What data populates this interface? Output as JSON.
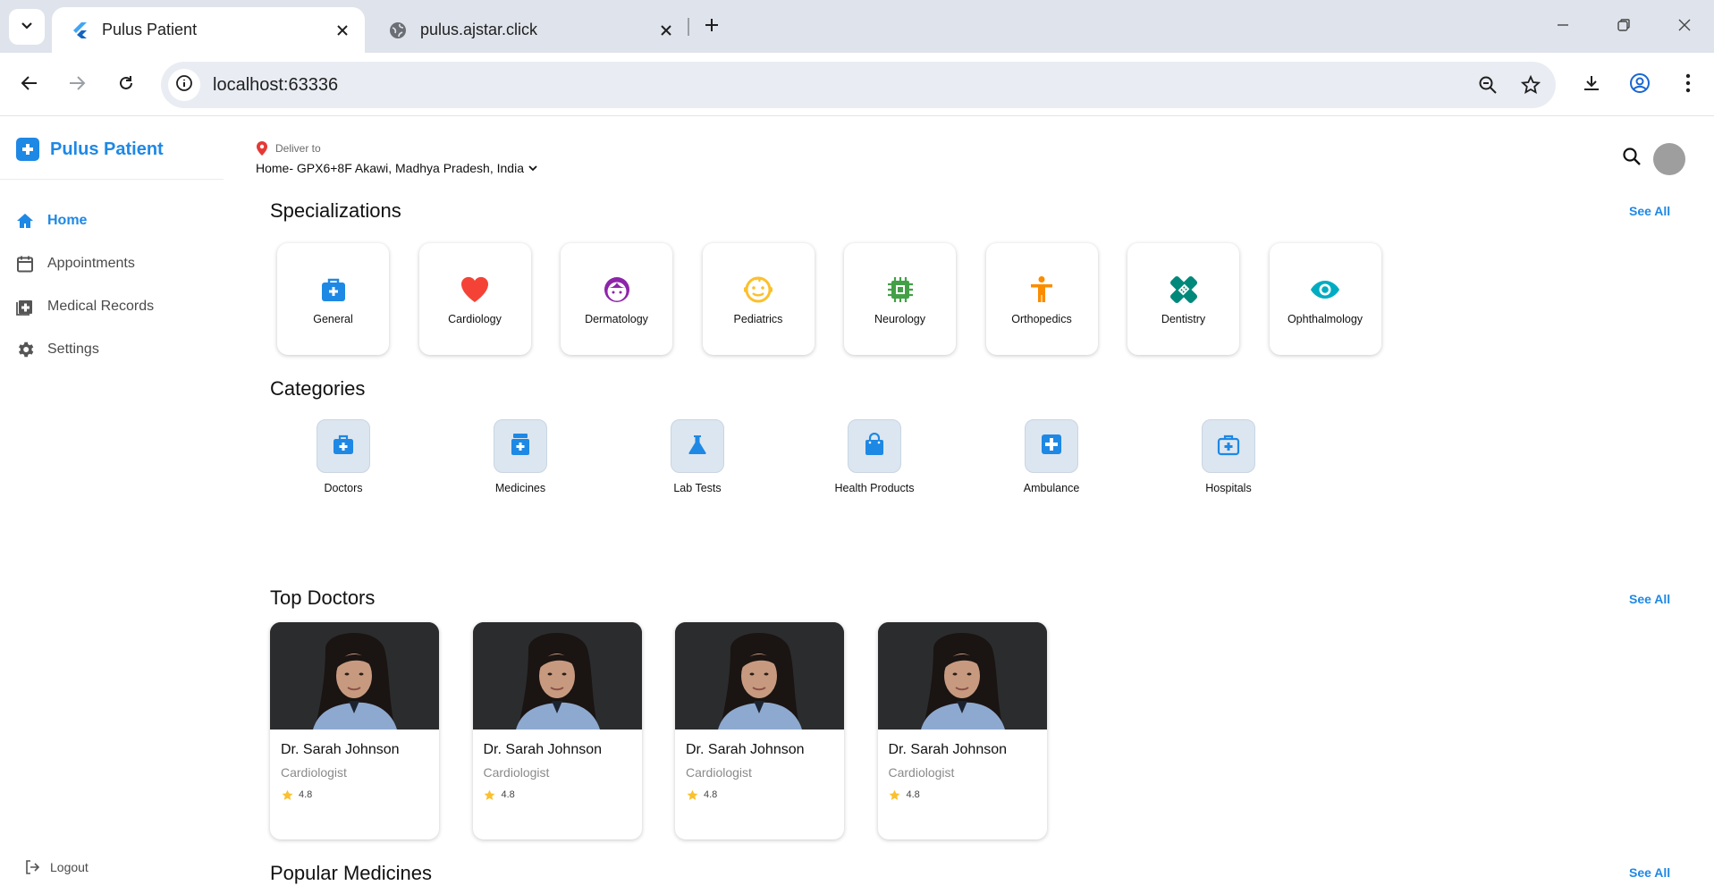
{
  "browser": {
    "tabs": [
      {
        "title": "Pulus Patient",
        "favicon": "flutter-icon",
        "active": true
      },
      {
        "title": "pulus.ajstar.click",
        "favicon": "globe-icon",
        "active": false
      }
    ],
    "url": "localhost:63336"
  },
  "app": {
    "brand": "Pulus Patient",
    "accent": "#1e88e5",
    "nav": [
      {
        "label": "Home",
        "icon": "home-icon",
        "active": true
      },
      {
        "label": "Appointments",
        "icon": "calendar-icon",
        "active": false
      },
      {
        "label": "Medical Records",
        "icon": "medical-records-icon",
        "active": false
      },
      {
        "label": "Settings",
        "icon": "gear-icon",
        "active": false
      }
    ],
    "logout": "Logout"
  },
  "header": {
    "deliver_label": "Deliver to",
    "address": "Home- GPX6+8F Akawi, Madhya Pradesh, India"
  },
  "specializations": {
    "title": "Specializations",
    "see_all": "See All",
    "items": [
      {
        "label": "General",
        "icon": "medical-bag-icon",
        "color": "#1e88e5"
      },
      {
        "label": "Cardiology",
        "icon": "heart-icon",
        "color": "#f44336"
      },
      {
        "label": "Dermatology",
        "icon": "face-icon",
        "color": "#8e24aa"
      },
      {
        "label": "Pediatrics",
        "icon": "child-face-icon",
        "color": "#fbc02d"
      },
      {
        "label": "Neurology",
        "icon": "chip-icon",
        "color": "#43a047"
      },
      {
        "label": "Orthopedics",
        "icon": "accessibility-icon",
        "color": "#fb8c00"
      },
      {
        "label": "Dentistry",
        "icon": "healing-icon",
        "color": "#00897b"
      },
      {
        "label": "Ophthalmology",
        "icon": "eye-icon",
        "color": "#00acc1"
      }
    ]
  },
  "categories": {
    "title": "Categories",
    "items": [
      {
        "label": "Doctors",
        "icon": "medical-bag-icon"
      },
      {
        "label": "Medicines",
        "icon": "medicine-icon"
      },
      {
        "label": "Lab Tests",
        "icon": "flask-icon"
      },
      {
        "label": "Health Products",
        "icon": "shopping-bag-icon"
      },
      {
        "label": "Ambulance",
        "icon": "medical-cross-icon"
      },
      {
        "label": "Hospitals",
        "icon": "hospital-kit-icon"
      }
    ]
  },
  "top_doctors": {
    "title": "Top Doctors",
    "see_all": "See All",
    "doctors": [
      {
        "name": "Dr. Sarah Johnson",
        "specialty": "Cardiologist",
        "rating": "4.8"
      },
      {
        "name": "Dr. Sarah Johnson",
        "specialty": "Cardiologist",
        "rating": "4.8"
      },
      {
        "name": "Dr. Sarah Johnson",
        "specialty": "Cardiologist",
        "rating": "4.8"
      },
      {
        "name": "Dr. Sarah Johnson",
        "specialty": "Cardiologist",
        "rating": "4.8"
      }
    ]
  },
  "popular_medicines": {
    "title": "Popular Medicines",
    "see_all": "See All"
  }
}
